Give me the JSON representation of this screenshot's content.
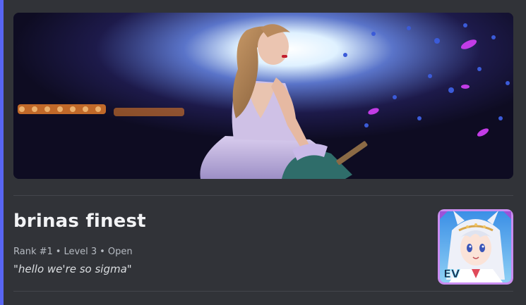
{
  "server": {
    "name": "brinas finest",
    "rank": "Rank #1",
    "level": "Level 3",
    "status": "Open",
    "separator": "•",
    "tagline": "\"hello we're so sigma\"",
    "thumbnail_badge": "EV"
  },
  "icons": {
    "banner": "concert-performer-image",
    "thumbnail": "anime-character-avatar"
  },
  "colors": {
    "background": "#313338",
    "accent": "#5865f2",
    "divider": "#43454c",
    "title": "#f2f3f5",
    "meta": "#b5bac1",
    "thumb_border": "#c98df0"
  }
}
